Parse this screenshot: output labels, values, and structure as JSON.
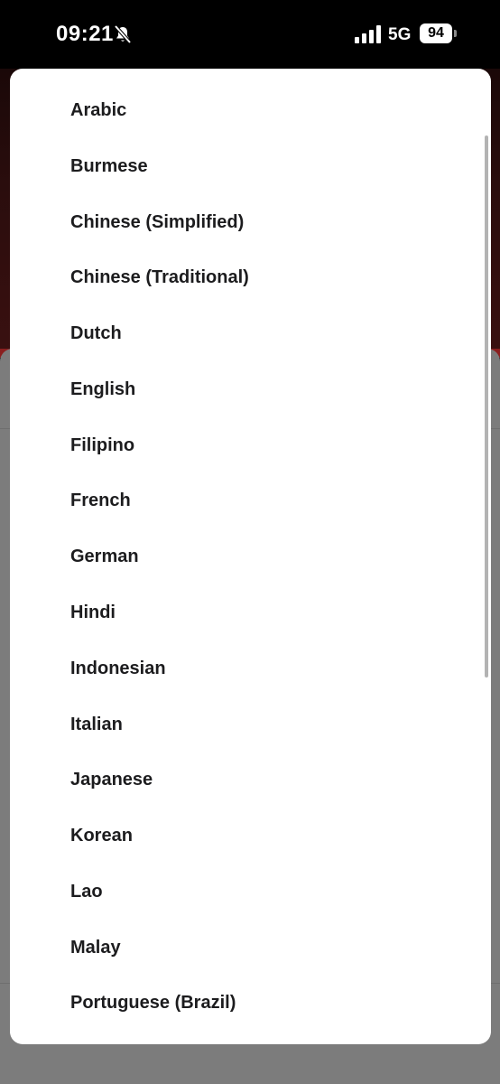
{
  "status_bar": {
    "time": "09:21",
    "network": "5G",
    "battery": "94",
    "icons": [
      "bell-slash-icon",
      "signal-icon"
    ]
  },
  "language_menu": {
    "items": [
      "Arabic",
      "Burmese",
      "Chinese (Simplified)",
      "Chinese (Traditional)",
      "Dutch",
      "English",
      "Filipino",
      "French",
      "German",
      "Hindi",
      "Indonesian",
      "Italian",
      "Japanese",
      "Korean",
      "Lao",
      "Malay",
      "Portuguese (Brazil)"
    ]
  },
  "colors": {
    "menu_background": "#ffffff",
    "item_text": "#1c1c1e",
    "dim_overlay": "#7c7c7c"
  }
}
